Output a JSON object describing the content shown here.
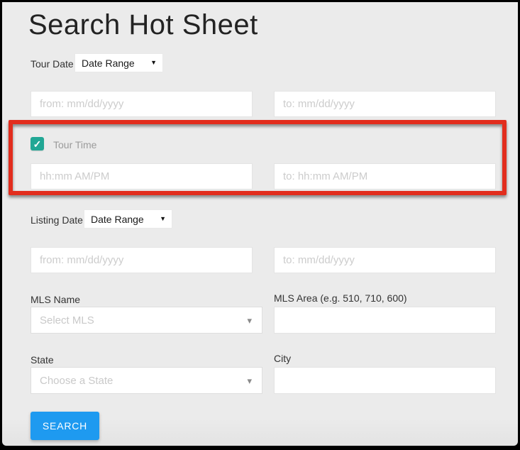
{
  "page": {
    "title": "Search Hot Sheet"
  },
  "tour_date": {
    "label": "Tour Date:",
    "selected_option": "Date Range",
    "from_placeholder": "from: mm/dd/yyyy",
    "to_placeholder": "to: mm/dd/yyyy"
  },
  "tour_time": {
    "label": "Tour Time",
    "checked": true,
    "from_placeholder": "hh:mm AM/PM",
    "to_placeholder": "to: hh:mm AM/PM"
  },
  "listing_date": {
    "label": "Listing Date:",
    "selected_option": "Date Range",
    "from_placeholder": "from: mm/dd/yyyy",
    "to_placeholder": "to: mm/dd/yyyy"
  },
  "mls": {
    "name_label": "MLS Name",
    "name_placeholder": "Select MLS",
    "area_label": "MLS Area (e.g. 510, 710, 600)",
    "area_value": ""
  },
  "location": {
    "state_label": "State",
    "state_placeholder": "Choose a State",
    "city_label": "City",
    "city_value": ""
  },
  "actions": {
    "search_label": "SEARCH"
  },
  "icons": {
    "checkmark": "✓",
    "select_caret": "▼",
    "dropdown_caret": "▾"
  },
  "colors": {
    "background": "#ebebeb",
    "accent_blue": "#1e9af0",
    "checkbox_teal": "#21a795",
    "annotation_red": "#e22d1d"
  }
}
